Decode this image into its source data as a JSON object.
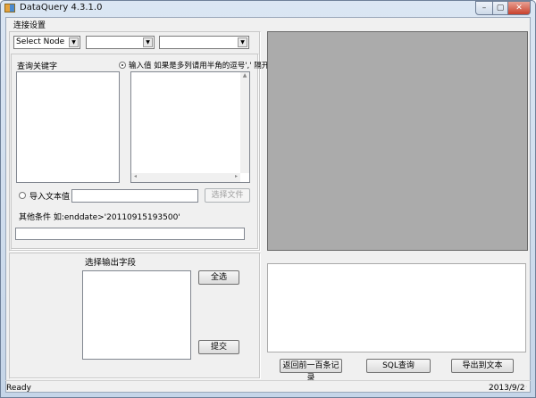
{
  "window": {
    "title": "DataQuery 4.3.1.0",
    "minimize": "–",
    "maximize": "▢",
    "close": "✕"
  },
  "menu": {
    "connection_settings": "连接设置"
  },
  "query": {
    "node_select": "Select Node",
    "select2": "",
    "select3": "",
    "keyword_label": "查询关键字",
    "input_value_label": "输入值 如果是多列请用半角的逗号',' 隔开",
    "import_text_label": "导入文本值",
    "import_path": "",
    "choose_file": "选择文件",
    "other_condition_label": "其他条件 如:enddate>'20110915193500'",
    "other_condition": ""
  },
  "output": {
    "label": "选择输出字段",
    "select_all": "全选",
    "submit": "提交"
  },
  "actions": {
    "back100": "返回前一百条记录",
    "sql_query": "SQL查询",
    "export_text": "导出到文本"
  },
  "status": {
    "left": "Ready",
    "right": "2013/9/2"
  }
}
